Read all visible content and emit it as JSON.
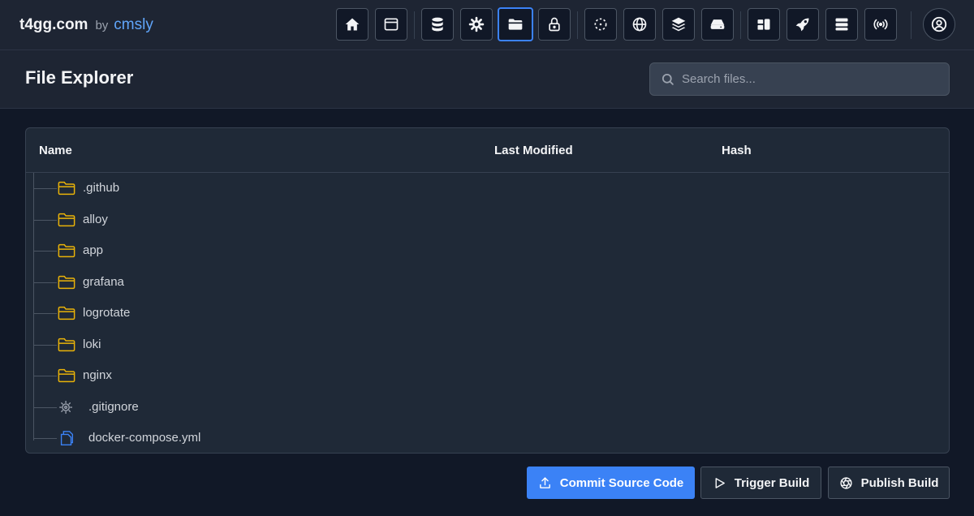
{
  "brand": {
    "name": "t4gg.com",
    "by": "by",
    "author": "cmsly"
  },
  "nav": {
    "buttons": [
      {
        "name": "home-icon"
      },
      {
        "name": "browser-window-icon"
      },
      {
        "name": "database-icon"
      },
      {
        "name": "gear-icon"
      },
      {
        "name": "folder-open-icon",
        "active": true
      },
      {
        "name": "lock-icon"
      },
      {
        "name": "dashed-circle-icon"
      },
      {
        "name": "globe-icon"
      },
      {
        "name": "layers-icon"
      },
      {
        "name": "hard-drive-icon"
      },
      {
        "name": "widgets-icon"
      },
      {
        "name": "rocket-icon"
      },
      {
        "name": "server-icon"
      },
      {
        "name": "broadcast-icon"
      }
    ],
    "user": "user-circle-icon"
  },
  "header": {
    "title": "File Explorer"
  },
  "search": {
    "placeholder": "Search files...",
    "value": ""
  },
  "table": {
    "columns": [
      "Name",
      "Last Modified",
      "Hash"
    ],
    "rows": [
      {
        "name": ".github",
        "type": "folder",
        "modified": "",
        "hash": ""
      },
      {
        "name": "alloy",
        "type": "folder",
        "modified": "",
        "hash": ""
      },
      {
        "name": "app",
        "type": "folder",
        "modified": "",
        "hash": ""
      },
      {
        "name": "grafana",
        "type": "folder",
        "modified": "",
        "hash": ""
      },
      {
        "name": "logrotate",
        "type": "folder",
        "modified": "",
        "hash": ""
      },
      {
        "name": "loki",
        "type": "folder",
        "modified": "",
        "hash": ""
      },
      {
        "name": "nginx",
        "type": "folder",
        "modified": "",
        "hash": ""
      },
      {
        "name": ".gitignore",
        "type": "settings-file",
        "modified": "",
        "hash": ""
      },
      {
        "name": "docker-compose.yml",
        "type": "file",
        "modified": "",
        "hash": ""
      }
    ]
  },
  "actions": {
    "commit": "Commit Source Code",
    "trigger": "Trigger Build",
    "publish": "Publish Build"
  },
  "colors": {
    "accent": "#3b82f6",
    "brand_author": "#60a5fa",
    "folder": "#eab308",
    "file": "#3b82f6",
    "settings_file": "#9ca3af"
  }
}
